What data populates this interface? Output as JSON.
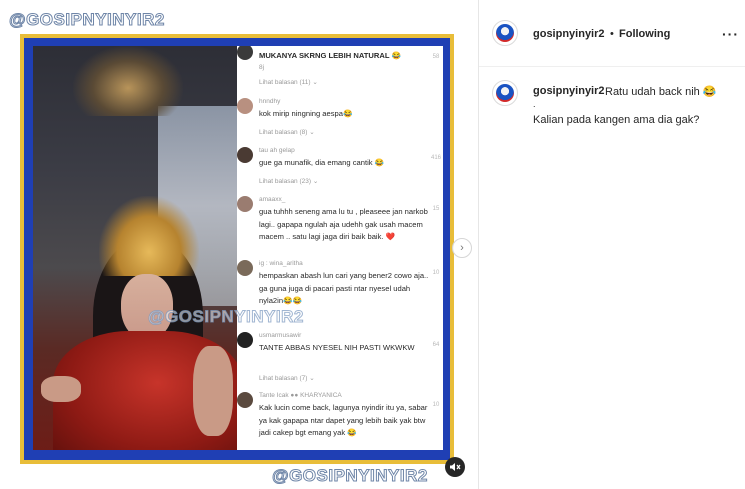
{
  "media": {
    "watermark_top": "@GOSIPNYINYIR2",
    "watermark_mid": "@GOSIPNYINYIR2",
    "watermark_bottom": "@GOSIPNYINYIR2",
    "comments": [
      {
        "user": "",
        "text": "MUKANYA SKRNG LEBIH NATURAL 😂",
        "meta": "8j",
        "reply": "Lihat balasan (11) ⌄",
        "likes": "58"
      },
      {
        "user": "hnndhy",
        "text": "kok mirip ningning aespa😂",
        "meta": "9j",
        "reply": "Lihat balasan (8) ⌄",
        "likes": ""
      },
      {
        "user": "tau ah gelap",
        "text": "gue ga munafik, dia emang cantik 😂",
        "meta": "9j",
        "reply": "Lihat balasan (23) ⌄",
        "likes": "416"
      },
      {
        "user": "amaaxx_",
        "text": "gua tuhhh seneng ama lu tu , pleaseee jan narkob lagi.. gapapa ngulah aja udehh gak usah macem macem .. satu lagi jaga diri baik baik. ❤️",
        "meta": "9j",
        "reply": "",
        "likes": "15"
      },
      {
        "user": "ig : wina_aritha",
        "text": "hempaskan abash lun cari yang bener2 cowo aja.. ga guna juga di pacari pasti ntar nyesel udah nyla2in😂😂",
        "meta": "9j",
        "reply": "",
        "likes": "10"
      },
      {
        "user": "usmarmusawir",
        "text": "TANTE ABBAS NYESEL NIH PASTI WKWKW",
        "meta": "8j",
        "reply": "Lihat balasan (7) ⌄",
        "likes": "64"
      },
      {
        "user": "Tante Icak ●● KHARYANICA",
        "text": "Kak lucin come back, lagunya nyindir itu ya, sabar ya kak gapapa ntar dapet yang lebih baik yak btw jadi cakep bgt emang yak 😂",
        "meta": "",
        "reply": "",
        "likes": "10"
      }
    ]
  },
  "header": {
    "username": "gosipnyinyir2",
    "dot": "•",
    "follow_status": "Following",
    "more": "···"
  },
  "caption": {
    "username": "gosipnyinyir2",
    "line1": "Ratu udah back nih 😂",
    "dot": ".",
    "line2": "Kalian pada kangen ama dia gak?"
  },
  "icons": {
    "next": "chevron-right-icon",
    "mute": "speaker-muted-icon",
    "more": "more-horizontal-icon"
  }
}
